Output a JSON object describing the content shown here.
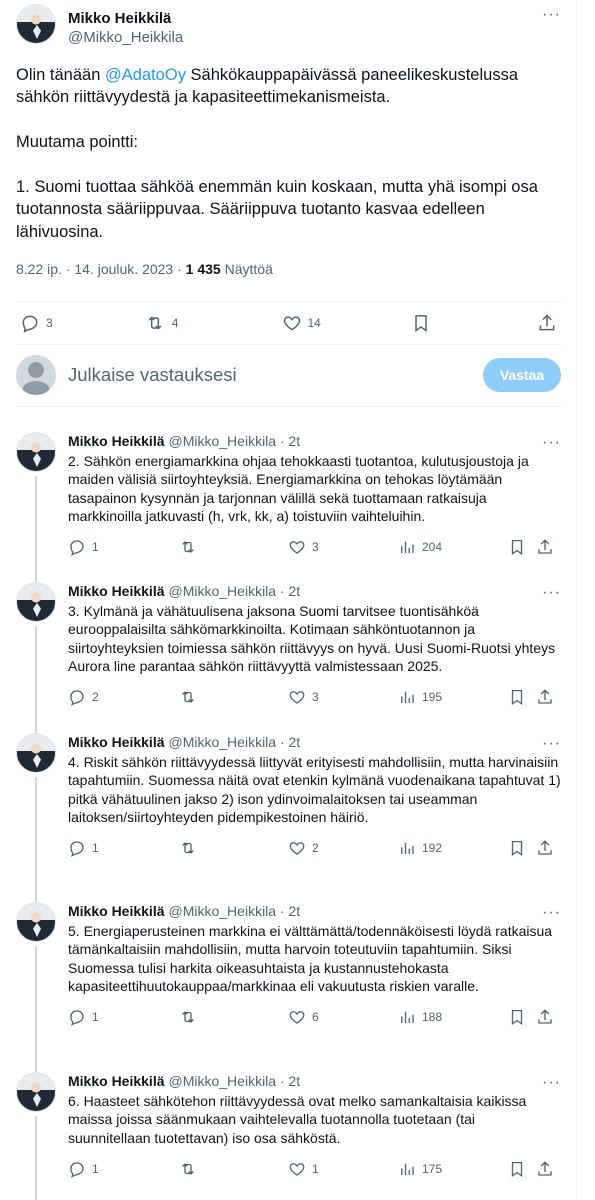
{
  "main_tweet": {
    "name": "Mikko Heikkilä",
    "handle": "@Mikko_Heikkila",
    "more": "···",
    "text_before_mention": "Olin tänään ",
    "mention": "@AdatoOy",
    "text_after_mention": " Sähkökauppapäivässä paneelikeskustelussa sähkön riittävyydestä ja kapasiteettimekanismeista.\n\nMuutama pointti:\n\n1. Suomi tuottaa sähköä enemmän kuin koskaan, mutta yhä isompi osa tuotannosta sääriippuvaa. Sääriippuva tuotanto kasvaa edelleen lähivuosina.",
    "timestamp": "8.22 ip. · 14. jouluk. 2023 · ",
    "views": "1 435",
    "views_label": " Näyttöä",
    "reply_count": "3",
    "retweet_count": "4",
    "like_count": "14"
  },
  "reply_box": {
    "placeholder": "Julkaise vastauksesi",
    "button": "Vastaa"
  },
  "replies": [
    {
      "name": "Mikko Heikkilä",
      "handle": "@Mikko_Heikkila · 2t",
      "more": "···",
      "text": "2. Sähkön energiamarkkina ohjaa tehokkaasti tuotantoa, kulutusjoustoja ja maiden välisiä siirtoyhteyksiä. Energiamarkkina on tehokas löytämään tasapainon kysynnän ja tarjonnan välillä sekä tuottamaan ratkaisuja markkinoilla jatkuvasti (h, vrk, kk, a) toistuviin vaihteluihin.",
      "replies": "1",
      "retweets": "",
      "likes": "3",
      "views": "204"
    },
    {
      "name": "Mikko Heikkilä",
      "handle": "@Mikko_Heikkila · 2t",
      "more": "···",
      "text": "3. Kylmänä ja vähätuulisena jaksona Suomi tarvitsee tuontisähköä eurooppalaisilta sähkömarkkinoilta. Kotimaan sähköntuotannon ja siirtoyhteyksien toimiessa sähkön riittävyys on hyvä. Uusi Suomi-Ruotsi yhteys Aurora line parantaa sähkön riittävyyttä valmistessaan 2025.",
      "replies": "2",
      "retweets": "",
      "likes": "3",
      "views": "195"
    },
    {
      "name": "Mikko Heikkilä",
      "handle": "@Mikko_Heikkila · 2t",
      "more": "···",
      "text": "4. Riskit sähkön riittävyydessä liittyvät erityisesti mahdollisiin, mutta harvinaisiin tapahtumiin. Suomessa näitä ovat etenkin kylmänä vuodenaikana tapahtuvat 1) pitkä vähätuulinen jakso 2) ison ydinvoimalaitoksen tai useamman laitoksen/siirtoyhteyden pidempikestoinen häiriö.",
      "replies": "1",
      "retweets": "",
      "likes": "2",
      "views": "192"
    },
    {
      "name": "Mikko Heikkilä",
      "handle": "@Mikko_Heikkila · 2t",
      "more": "···",
      "text": "5. Energiaperusteinen markkina ei välttämättä/todennäköisesti löydä ratkaisua tämänkaltaisiin mahdollisiin, mutta harvoin toteutuviin tapahtumiin. Siksi Suomessa tulisi harkita oikeasuhtaista ja kustannustehokasta kapasiteettihuutokauppaa/markkinaa eli vakuutusta riskien varalle.",
      "replies": "1",
      "retweets": "",
      "likes": "6",
      "views": "188"
    },
    {
      "name": "Mikko Heikkilä",
      "handle": "@Mikko_Heikkila · 2t",
      "more": "···",
      "text": "6. Haasteet sähkötehon riittävyydessä ovat melko samankaltaisia kaikissa maissa joissa säänmukaan vaihtelevalla tuotannolla tuotetaan (tai suunnitellaan tuotettavan) iso osa sähköstä.",
      "replies": "1",
      "retweets": "",
      "likes": "1",
      "views": "175"
    }
  ]
}
